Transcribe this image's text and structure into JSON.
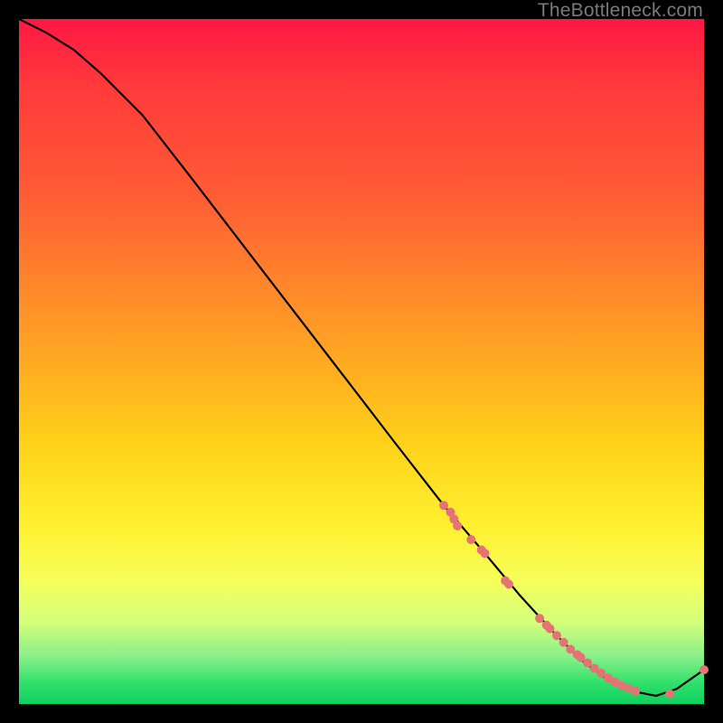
{
  "watermark": "TheBottleneck.com",
  "chart_data": {
    "type": "line",
    "title": "",
    "xlabel": "",
    "ylabel": "",
    "xlim": [
      0,
      100
    ],
    "ylim": [
      0,
      100
    ],
    "grid": false,
    "series": [
      {
        "name": "curve",
        "x": [
          0,
          4,
          8,
          12,
          18,
          25,
          35,
          45,
          55,
          62,
          68,
          73,
          78,
          82,
          86,
          90,
          93,
          96,
          100
        ],
        "y": [
          100,
          98,
          95.5,
          92,
          86,
          77,
          64,
          51,
          38,
          29,
          22,
          16,
          10.5,
          6.5,
          3.5,
          1.8,
          1.2,
          2.2,
          5
        ]
      }
    ],
    "scatter_points": {
      "name": "markers",
      "color": "#e57373",
      "x": [
        62,
        63,
        63.5,
        64,
        66,
        67.5,
        68,
        71,
        71.5,
        76,
        77,
        77.5,
        78.5,
        79.5,
        80.5,
        81.5,
        82,
        83,
        84,
        85,
        86,
        87,
        88,
        89,
        90,
        95,
        100
      ],
      "y": [
        29,
        28,
        27,
        26,
        24,
        22.5,
        22,
        18,
        17.5,
        12.5,
        11.5,
        11,
        10,
        9,
        8,
        7.2,
        6.8,
        6,
        5.2,
        4.5,
        3.8,
        3.2,
        2.7,
        2.3,
        1.9,
        1.5,
        5
      ]
    }
  }
}
